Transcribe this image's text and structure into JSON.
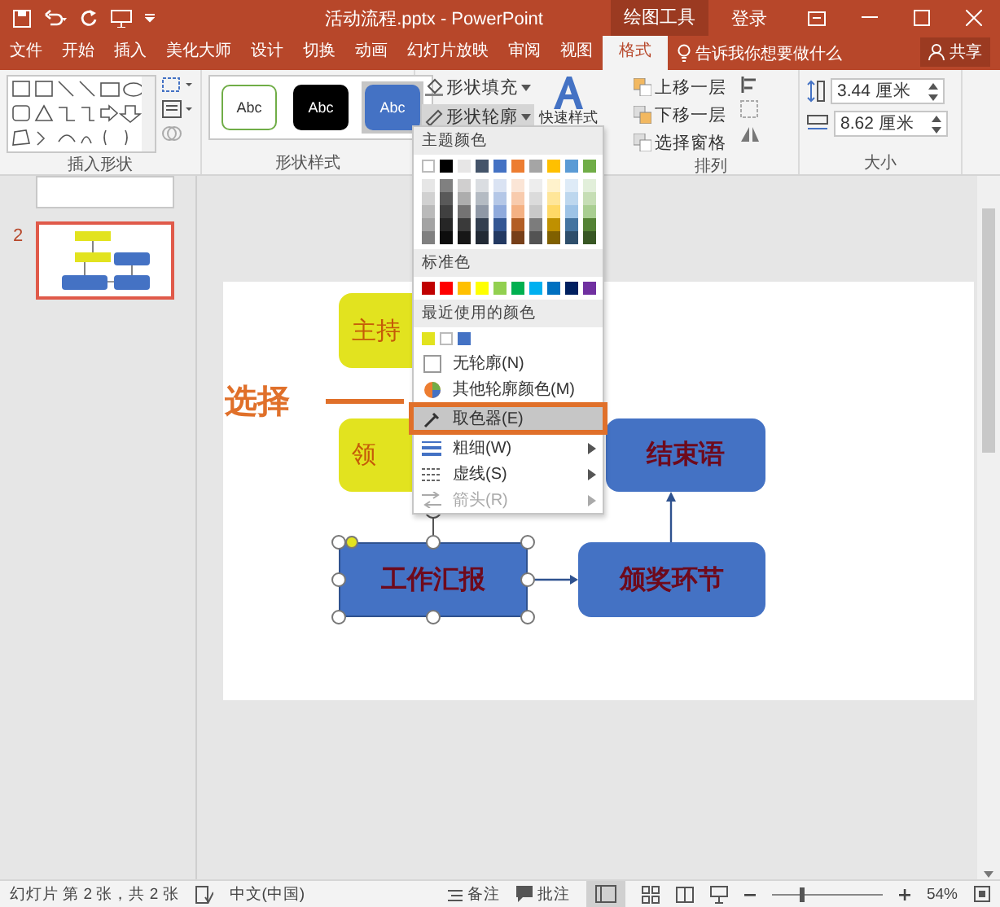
{
  "title_bar": {
    "title": "活动流程.pptx - PowerPoint",
    "context_tab": "绘图工具",
    "sign_in": "登录"
  },
  "tabs": [
    {
      "label": "文件",
      "selected": false
    },
    {
      "label": "开始",
      "selected": false
    },
    {
      "label": "插入",
      "selected": false
    },
    {
      "label": "美化大师",
      "selected": false
    },
    {
      "label": "设计",
      "selected": false
    },
    {
      "label": "切换",
      "selected": false
    },
    {
      "label": "动画",
      "selected": false
    },
    {
      "label": "幻灯片放映",
      "selected": false
    },
    {
      "label": "审阅",
      "selected": false
    },
    {
      "label": "视图",
      "selected": false
    },
    {
      "label": "格式",
      "selected": true
    }
  ],
  "tell_me": "告诉我你想要做什么",
  "share": "共享",
  "ribbon": {
    "insert_shapes": {
      "label": "插入形状"
    },
    "shape_styles": {
      "label": "形状样式",
      "styles": [
        {
          "text": "Abc",
          "kind": "outline",
          "selected": false
        },
        {
          "text": "Abc",
          "kind": "dark",
          "selected": false
        },
        {
          "text": "Abc",
          "kind": "blue",
          "selected": true
        }
      ]
    },
    "shape_fill": "形状填充",
    "shape_outline": "形状轮廓",
    "quick_styles": "快速样式",
    "arrange": {
      "label": "排列",
      "items": [
        "上移一层",
        "下移一层",
        "选择窗格"
      ]
    },
    "size": {
      "label": "大小",
      "height": "3.44 厘米",
      "width": "8.62 厘米"
    }
  },
  "slides": [
    {
      "selected": false
    },
    {
      "number": "2",
      "selected": true
    }
  ],
  "slide": {
    "callout": "选择",
    "shapes": [
      {
        "text": "主持",
        "kind": "yellow",
        "selected": false
      },
      {
        "text": "领",
        "kind": "yellow",
        "selected": false
      },
      {
        "text": "结束语",
        "kind": "blue",
        "selected": false
      },
      {
        "text": "工作汇报",
        "kind": "blue",
        "selected": true
      },
      {
        "text": "颁奖环节",
        "kind": "blue",
        "selected": false
      }
    ]
  },
  "menu": {
    "theme_header": "主题颜色",
    "theme_colors": [
      {
        "color": "#ffffff"
      },
      {
        "color": "#000000"
      },
      {
        "color": "#e7e6e6"
      },
      {
        "color": "#44546a"
      },
      {
        "color": "#4472c4"
      },
      {
        "color": "#ed7d31"
      },
      {
        "color": "#a5a5a5"
      },
      {
        "color": "#ffc000"
      },
      {
        "color": "#5b9bd5"
      },
      {
        "color": "#70ad47"
      }
    ],
    "standard_header": "标准色",
    "standard_colors": [
      {
        "color": "#c00000"
      },
      {
        "color": "#ff0000"
      },
      {
        "color": "#ffc000"
      },
      {
        "color": "#ffff00"
      },
      {
        "color": "#92d050"
      },
      {
        "color": "#00b050"
      },
      {
        "color": "#00b0f0"
      },
      {
        "color": "#0070c0"
      },
      {
        "color": "#002060"
      },
      {
        "color": "#7030a0"
      }
    ],
    "recent_header": "最近使用的颜色",
    "recent_colors": [
      {
        "color": "#e2e31f"
      },
      {
        "color": "#ffffff"
      },
      {
        "color": "#4472c4"
      }
    ],
    "items": [
      {
        "label": "无轮廓(N)",
        "kind": "no-outline",
        "highlighted": false,
        "submenu": false,
        "disabled": false
      },
      {
        "label": "其他轮廓颜色(M)",
        "kind": "more-colors",
        "highlighted": false,
        "submenu": false,
        "disabled": false
      },
      {
        "label": "取色器(E)",
        "kind": "eyedropper",
        "highlighted": true,
        "submenu": false,
        "disabled": false
      },
      {
        "label": "粗细(W)",
        "kind": "weight",
        "highlighted": false,
        "submenu": true,
        "disabled": false
      },
      {
        "label": "虚线(S)",
        "kind": "dashes",
        "highlighted": false,
        "submenu": true,
        "disabled": false
      },
      {
        "label": "箭头(R)",
        "kind": "arrows",
        "highlighted": false,
        "submenu": true,
        "disabled": true
      }
    ]
  },
  "status_bar": {
    "slide_info": "幻灯片 第 2 张，共 2 张",
    "language": "中文(中国)",
    "notes": "备注",
    "comments": "批注",
    "zoom": {
      "level": 0.25,
      "reading": "54%"
    }
  }
}
